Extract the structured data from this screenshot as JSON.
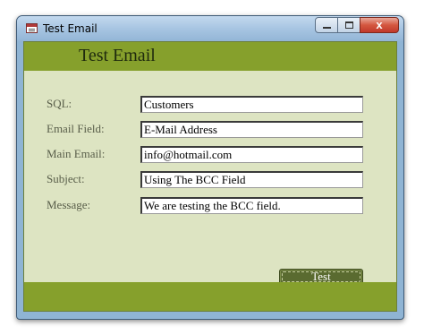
{
  "window": {
    "title": "Test Email",
    "close_label": "x"
  },
  "form": {
    "title": "Test Email",
    "fields": [
      {
        "label": "SQL:",
        "value": "Customers"
      },
      {
        "label": "Email Field:",
        "value": "E-Mail Address"
      },
      {
        "label": "Main Email:",
        "value": "info@hotmail.com"
      },
      {
        "label": "Subject:",
        "value": "Using The BCC Field"
      },
      {
        "label": "Message:",
        "value": "We are testing the BCC field."
      }
    ],
    "test_button": "Test"
  },
  "colors": {
    "band": "#86a02c",
    "form_background": "#dde4c2",
    "button": "#5a6b30"
  }
}
